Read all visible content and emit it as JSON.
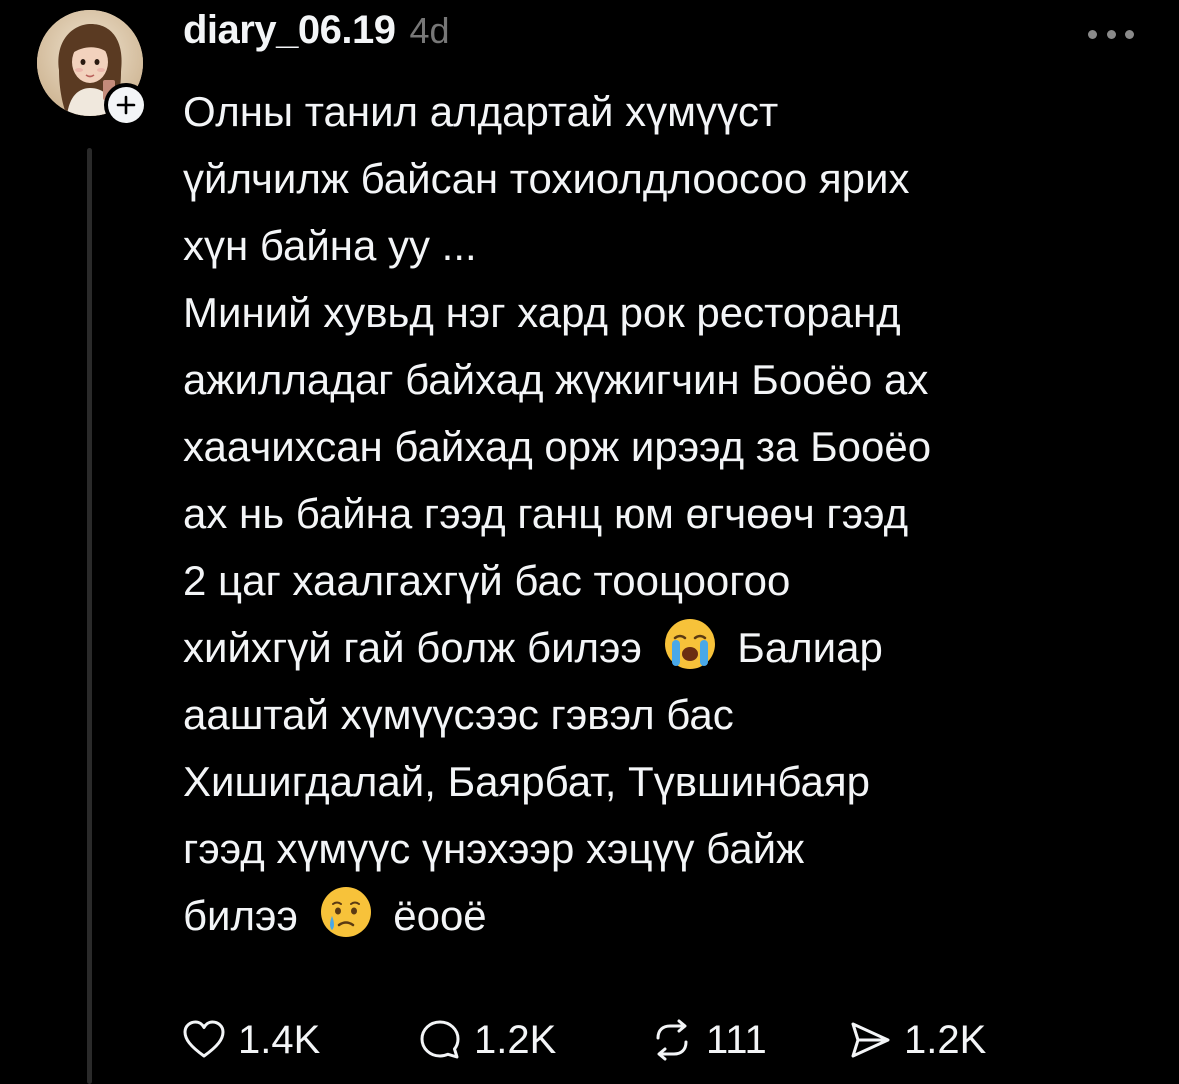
{
  "post": {
    "username": "diary_06.19",
    "time": "4d",
    "body_lines": [
      "Олны танил алдартай хүмүүст",
      "үйлчилж байсан тохиолдлоосоо ярих",
      "хүн байна уу ...",
      "Миний хувьд нэг хард рок ресторанд",
      "ажилладаг байхад жүжигчин Бооёо ах",
      "хаачихсан байхад орж ирээд за Бооёо",
      "ах нь байна гээд ганц юм өгчөөч гээд",
      "2 цаг хаалгахгүй бас тооцоогоо"
    ],
    "line9_before": "хийхгүй гай болж билээ",
    "line9_after": "Балиар",
    "more_lines": [
      "ааштай хүмүүсээс гэвэл бас",
      "Хишигдалай, Баярбат, Түвшинбаяр",
      "гээд хүмүүс үнэхээр хэцүү байж"
    ],
    "last_before": "билээ",
    "last_after": "ёооё",
    "emojis": [
      "loudly-crying-face-icon",
      "crying-face-icon"
    ]
  },
  "actions": {
    "likes": "1.4K",
    "replies": "1.2K",
    "reposts": "111",
    "shares": "1.2K"
  },
  "colors": {
    "background": "#000000",
    "text": "#f3f5f7",
    "muted": "#777777",
    "thread_line": "#2a2a2a"
  }
}
